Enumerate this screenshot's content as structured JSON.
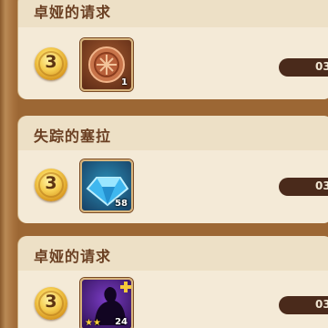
{
  "quests": [
    {
      "title": "卓娅的请求",
      "coin_value": "3",
      "reward_item": "bronze-coin-icon",
      "reward_count": "1",
      "progress_text": "03"
    },
    {
      "title": "失踪的塞拉",
      "coin_value": "3",
      "reward_item": "blue-gem-icon",
      "reward_count": "58",
      "progress_text": "03"
    },
    {
      "title": "卓娅的请求",
      "coin_value": "3",
      "reward_item": "hero-silhouette-icon",
      "reward_count": "24",
      "reward_stars": "★★",
      "progress_text": "03"
    }
  ],
  "colors": {
    "card": "#f4ead7",
    "title": "#6a3f22",
    "progress": "#4a2a1b",
    "frame": "#a8703e"
  }
}
